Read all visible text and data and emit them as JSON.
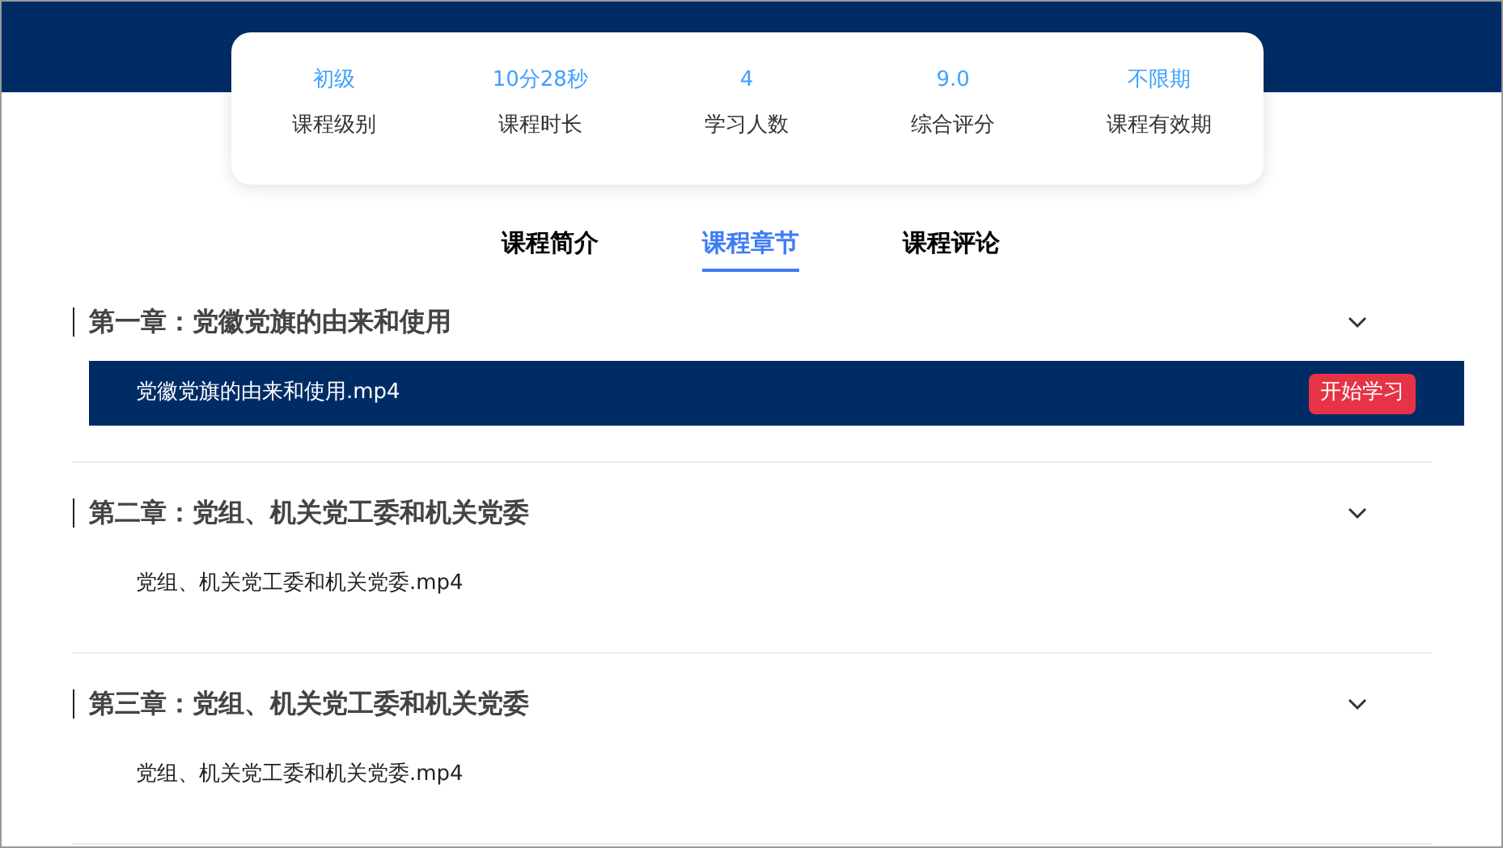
{
  "stats": [
    {
      "value": "初级",
      "label": "课程级别"
    },
    {
      "value": "10分28秒",
      "label": "课程时长"
    },
    {
      "value": "4",
      "label": "学习人数"
    },
    {
      "value": "9.0",
      "label": "综合评分"
    },
    {
      "value": "不限期",
      "label": "课程有效期"
    }
  ],
  "tabs": [
    {
      "label": "课程简介",
      "selected": false
    },
    {
      "label": "课程章节",
      "selected": true
    },
    {
      "label": "课程评论",
      "selected": false
    }
  ],
  "chapters": [
    {
      "title": "第一章：党徽党旗的由来和使用",
      "expanded": true,
      "lessons": [
        {
          "title": "党徽党旗的由来和使用.mp4",
          "selected": true,
          "action": "开始学习"
        }
      ]
    },
    {
      "title": "第二章：党组、机关党工委和机关党委",
      "expanded": true,
      "lessons": [
        {
          "title": "党组、机关党工委和机关党委.mp4",
          "selected": false
        }
      ]
    },
    {
      "title": "第三章：党组、机关党工委和机关党委",
      "expanded": true,
      "lessons": [
        {
          "title": "党组、机关党工委和机关党委.mp4",
          "selected": false
        }
      ]
    }
  ]
}
